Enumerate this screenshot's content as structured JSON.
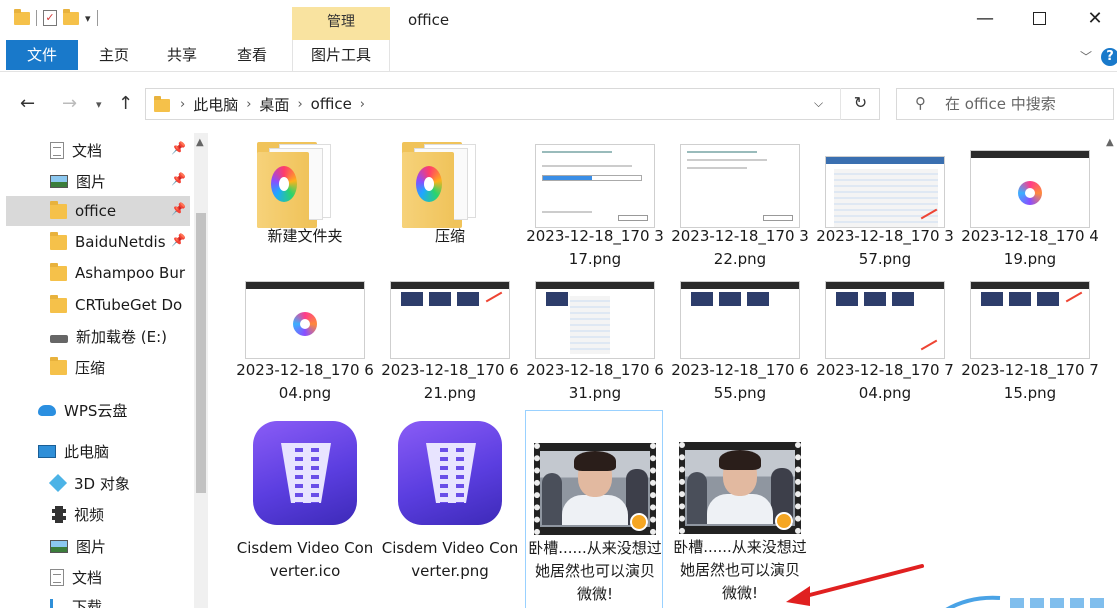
{
  "window": {
    "title": "office",
    "context_tab_group": "管理",
    "minimize_glyph": "—",
    "close_glyph": "✕"
  },
  "ribbon": {
    "tabs": [
      {
        "label": "文件"
      },
      {
        "label": "主页"
      },
      {
        "label": "共享"
      },
      {
        "label": "查看"
      },
      {
        "label": "图片工具"
      }
    ],
    "help_label": "?"
  },
  "address": {
    "crumbs": [
      "此电脑",
      "桌面",
      "office"
    ],
    "search_placeholder": "在 office 中搜索"
  },
  "sidebar": {
    "items": [
      {
        "label": "文档",
        "icon": "document-icon",
        "pinned": true
      },
      {
        "label": "图片",
        "icon": "picture-icon",
        "pinned": true
      },
      {
        "label": "office",
        "icon": "folder-icon",
        "pinned": true,
        "selected": true
      },
      {
        "label": "BaiduNetdis",
        "icon": "folder-icon",
        "pinned": true
      },
      {
        "label": "Ashampoo Bur",
        "icon": "folder-icon"
      },
      {
        "label": "CRTubeGet Do",
        "icon": "folder-icon"
      },
      {
        "label": "新加载卷 (E:)",
        "icon": "drive-icon"
      },
      {
        "label": "压缩",
        "icon": "folder-icon"
      },
      {
        "label": "WPS云盘",
        "icon": "cloud-icon"
      },
      {
        "label": "此电脑",
        "icon": "computer-icon"
      },
      {
        "label": "3D 对象",
        "icon": "3d-objects-icon"
      },
      {
        "label": "视频",
        "icon": "video-icon"
      },
      {
        "label": "图片",
        "icon": "picture-icon"
      },
      {
        "label": "文档",
        "icon": "document-icon"
      },
      {
        "label": "下载",
        "icon": "download-icon"
      }
    ]
  },
  "files": [
    {
      "name": "新建文件夹",
      "kind": "folder"
    },
    {
      "name": "压缩",
      "kind": "folder"
    },
    {
      "name": "2023-12-18_170 317.png",
      "kind": "shot-dialog"
    },
    {
      "name": "2023-12-18_170 322.png",
      "kind": "shot-dialog2"
    },
    {
      "name": "2023-12-18_170 357.png",
      "kind": "shot-explorer"
    },
    {
      "name": "2023-12-18_170 419.png",
      "kind": "shot-app"
    },
    {
      "name": "2023-12-18_170 604.png",
      "kind": "shot-app"
    },
    {
      "name": "2023-12-18_170 621.png",
      "kind": "shot-app2"
    },
    {
      "name": "2023-12-18_170 631.png",
      "kind": "shot-list"
    },
    {
      "name": "2023-12-18_170 655.png",
      "kind": "shot-app2"
    },
    {
      "name": "2023-12-18_170 704.png",
      "kind": "shot-app2"
    },
    {
      "name": "2023-12-18_170 715.png",
      "kind": "shot-app2"
    },
    {
      "name": "Cisdem Video Converter.ico",
      "kind": "app-icon"
    },
    {
      "name": "Cisdem Video Converter.png",
      "kind": "app-icon"
    },
    {
      "name": "卧槽......从来没想过她居然也可以演贝微微!",
      "kind": "video",
      "selected": true
    },
    {
      "name": "卧槽......从来没想过她居然也可以演贝微微!",
      "kind": "video"
    }
  ],
  "colors": {
    "accent": "#1979ca",
    "context_tab": "#f9e3a0",
    "selection": "#d9d9d9",
    "annotation": "#e02020"
  }
}
